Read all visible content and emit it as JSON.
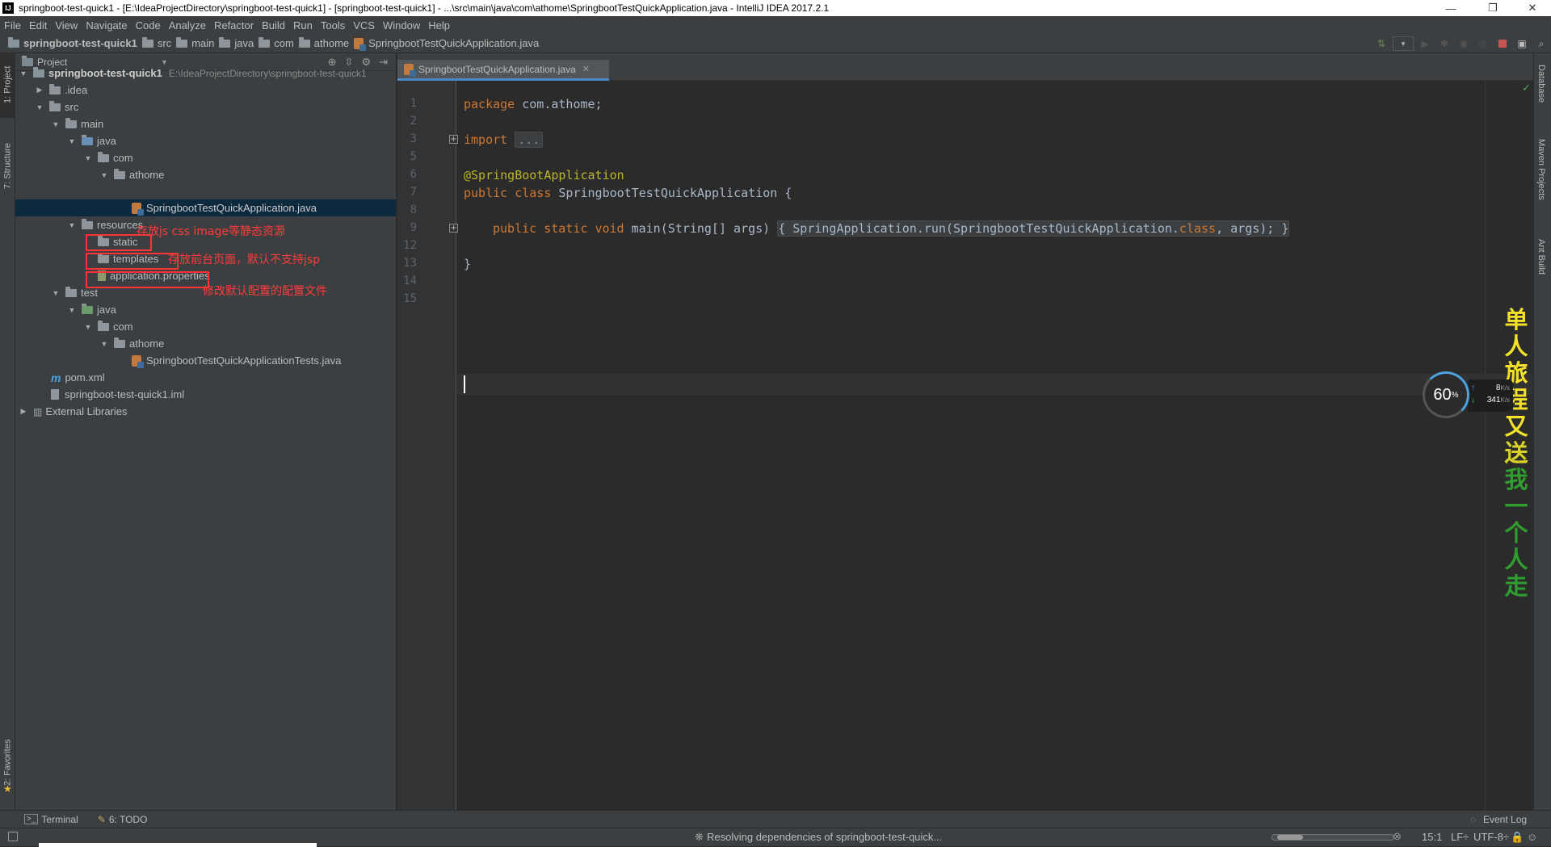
{
  "window": {
    "title": "springboot-test-quick1 - [E:\\IdeaProjectDirectory\\springboot-test-quick1] - [springboot-test-quick1] - ...\\src\\main\\java\\com\\athome\\SpringbootTestQuickApplication.java - IntelliJ IDEA 2017.2.1",
    "app_icon": "IJ",
    "minimize": "—",
    "restore": "❐",
    "close": "✕"
  },
  "menu": [
    "File",
    "Edit",
    "View",
    "Navigate",
    "Code",
    "Analyze",
    "Refactor",
    "Build",
    "Run",
    "Tools",
    "VCS",
    "Window",
    "Help"
  ],
  "breadcrumbs": [
    "springboot-test-quick1",
    "src",
    "main",
    "java",
    "com",
    "athome",
    "SpringbootTestQuickApplication.java"
  ],
  "left_tool_tabs": {
    "project": "1: Project",
    "structure": "7: Structure",
    "favorites": "2: Favorites"
  },
  "right_tool_tabs": {
    "database": "Database",
    "maven": "Maven Projects",
    "ant": "Ant Build"
  },
  "project_panel": {
    "header": "Project",
    "tree": [
      {
        "label": "springboot-test-quick1",
        "path": "E:\\IdeaProjectDirectory\\springboot-test-quick1"
      },
      {
        "label": ".idea"
      },
      {
        "label": "src"
      },
      {
        "label": "main"
      },
      {
        "label": "java"
      },
      {
        "label": "com"
      },
      {
        "label": "athome"
      },
      {
        "label": "SpringbootTestQuickApplication.java"
      },
      {
        "label": "resources"
      },
      {
        "label": "static"
      },
      {
        "label": "templates"
      },
      {
        "label": "application.properties"
      },
      {
        "label": "test"
      },
      {
        "label": "java"
      },
      {
        "label": "com"
      },
      {
        "label": "athome"
      },
      {
        "label": "SpringbootTestQuickApplicationTests.java"
      },
      {
        "label": "pom.xml"
      },
      {
        "label": "springboot-test-quick1.iml"
      },
      {
        "label": "External Libraries"
      }
    ],
    "annotations": [
      "存放js css image等静态资源",
      "存放前台页面，默认不支持jsp",
      "修改默认配置的配置文件"
    ]
  },
  "editor": {
    "tab_label": "SpringbootTestQuickApplication.java",
    "line_numbers": [
      "1",
      "2",
      "3",
      "5",
      "6",
      "7",
      "8",
      "9",
      "12",
      "13",
      "14",
      "15"
    ],
    "code": {
      "l1_kw": "package",
      "l1_rest": " com.athome;",
      "l3_kw": "import",
      "l3_fold": "...",
      "l6_ann": "@SpringBootApplication",
      "l7_kw1": "public",
      "l7_kw2": "class",
      "l7_rest": " SpringbootTestQuickApplication {",
      "l9_kw1": "public",
      "l9_kw2": "static",
      "l9_kw3": "void",
      "l9_sig": " main(String[] args)",
      "l9_body_open": "{",
      "l9_body": " SpringApplication.run(SpringbootTestQuickApplication.",
      "l9_kw4": "class",
      "l9_body2": ", args);",
      "l9_body_close": "}",
      "l13": "}"
    }
  },
  "bottom_tools": {
    "terminal": "Terminal",
    "todo": "6: TODO",
    "event_log": "Event Log"
  },
  "status": {
    "message": "Resolving dependencies of springboot-test-quick...",
    "position": "15:1",
    "line_sep": "LF÷",
    "encoding": "UTF-8÷"
  },
  "overlay": {
    "text_chars": [
      "单",
      "人",
      "旅",
      "程",
      "又",
      "送",
      "我",
      "一",
      "个",
      "人",
      "走"
    ],
    "speed_percent": "60",
    "percent_sign": "%",
    "upload": "8",
    "download": "341",
    "unit": "K/s"
  },
  "colors": {
    "keyword": "#cc7832",
    "annotation": "#bbb529",
    "overlay_yellow": "#f3e12a",
    "overlay_green": "#2f9e2f"
  }
}
